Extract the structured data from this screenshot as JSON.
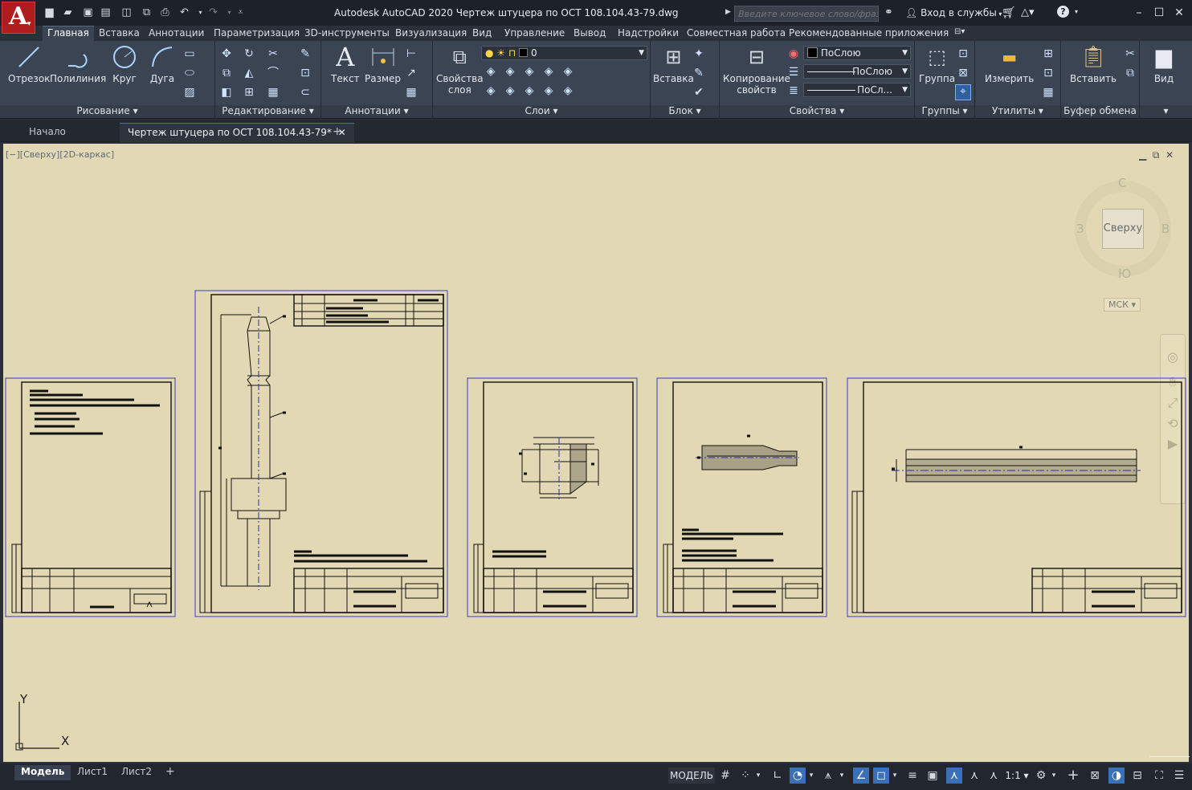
{
  "app": {
    "title": "Autodesk AutoCAD 2020   Чертеж штуцера по ОСТ 108.104.43-79.dwg",
    "logo_letter": "A",
    "search_placeholder": "Введите ключевое слово/фразу",
    "signin_label": "Вход в службы"
  },
  "ribbon_tabs": [
    "Главная",
    "Вставка",
    "Аннотации",
    "Параметризация",
    "3D-инструменты",
    "Визуализация",
    "Вид",
    "Управление",
    "Вывод",
    "Надстройки",
    "Совместная работа",
    "Рекомендованные приложения"
  ],
  "ribbon": {
    "draw": {
      "line": "Отрезок",
      "polyline": "Полилиния",
      "circle": "Круг",
      "arc": "Дуга",
      "panel": "Рисование"
    },
    "modify": {
      "panel": "Редактирование"
    },
    "annotation": {
      "text": "Текст",
      "dimension": "Размер",
      "panel": "Аннотации"
    },
    "layers": {
      "props_line1": "Свойства",
      "props_line2": "слоя",
      "current_layer": "0",
      "panel": "Слои"
    },
    "block": {
      "insert": "Вставка",
      "panel": "Блок"
    },
    "properties": {
      "match_line1": "Копирование",
      "match_line2": "свойств",
      "color": "ПоСлою",
      "linetype": "ПоСлою",
      "lineweight": "ПоСл...",
      "panel": "Свойства"
    },
    "groups": {
      "group": "Группа",
      "panel": "Группы"
    },
    "utilities": {
      "measure": "Измерить",
      "panel": "Утилиты"
    },
    "clipboard": {
      "paste": "Вставить",
      "panel": "Буфер обмена"
    },
    "view": {
      "label": "Вид"
    }
  },
  "file_tabs": {
    "start": "Начало",
    "drawing": "Чертеж штуцера по ОСТ 108.104.43-79*",
    "new": "+"
  },
  "viewport": {
    "label": "[−][Сверху][2D-каркас]",
    "viewcube": {
      "face": "Сверху",
      "north": "С",
      "south": "Ю",
      "west": "З",
      "east": "В"
    },
    "ucs_button": "МСК",
    "ucs_axes": {
      "x": "X",
      "y": "Y"
    }
  },
  "layout_tabs": {
    "model": "Модель",
    "sheet1": "Лист1",
    "sheet2": "Лист2",
    "add": "+"
  },
  "status": {
    "space": "МОДЕЛЬ",
    "scale": "1:1"
  },
  "colors": {
    "canvas": "#e2d8b3",
    "sheet_border": "#3c3cc8",
    "drawing_lines": "#111111",
    "centerline": "#2a2ac0"
  }
}
